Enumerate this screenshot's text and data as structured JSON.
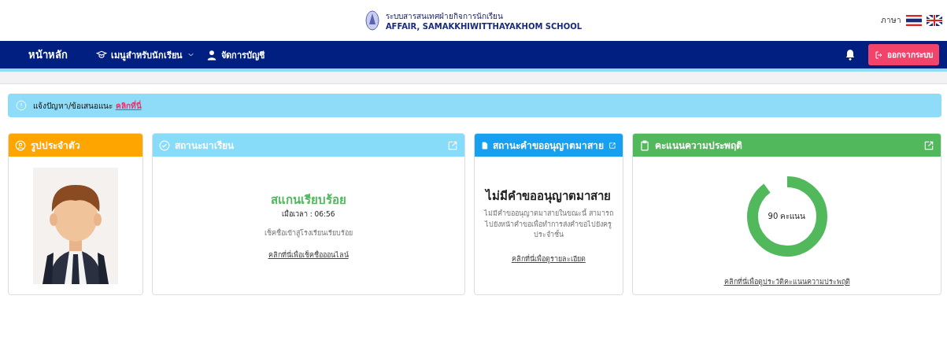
{
  "header": {
    "system_name": "ระบบสารสนเทศฝ่ายกิจการนักเรียน",
    "school_name": "AFFAIR, SAMAKKHIWITTHAYAKHOM SCHOOL",
    "language_label": "ภาษา",
    "languages": [
      {
        "kind": "thai"
      },
      {
        "kind": "english"
      }
    ]
  },
  "navbar": {
    "home": "หน้าหลัก",
    "items": [
      {
        "kind": "menu",
        "label": "เมนูสำหรับนักเรียน"
      },
      {
        "kind": "account",
        "label": "จัดการบัญชี"
      }
    ],
    "logout": "ออกจากระบบ"
  },
  "alert": {
    "text": "แจ้งปัญหา/ข้อเสนอแนะ",
    "link": "คลิกที่นี่"
  },
  "cards": [
    {
      "kind": "profile",
      "title": "รูปประจำตัว",
      "color": "#ffa500"
    },
    {
      "kind": "attendance",
      "title": "สถานะมาเรียน",
      "color": "#87dcfa",
      "headline": "สแกนเรียบร้อย",
      "time": "เมื่อเวลา : 06:56",
      "note": "เช็คชื่อเข้าสู่โรงเรียนเรียบร้อย",
      "link": "คลิกที่นี่เพื่อเช็คชื่อออนไลน์"
    },
    {
      "kind": "leave",
      "title": "สถานะคำขออนุญาตมาสาย",
      "color": "#18a0f0",
      "headline": "ไม่มีคำขออนุญาตมาสาย",
      "note": "ไม่มีคำขออนุญาตมาสายในขณะนี้ สามารถไปยังหน้าคำขอเพื่อทำการส่งคำขอไปยังครูประจำชั้น",
      "link": "คลิกที่นี่เพื่อดูรายละเอียด"
    },
    {
      "kind": "behavior",
      "title": "คะแนนความประพฤติ",
      "color": "#52b85c",
      "score": "90 คะแนน",
      "level": 0.9,
      "link": "คลิกที่นี่เพื่อดูประวัติคะแนนความประพฤติ"
    }
  ]
}
